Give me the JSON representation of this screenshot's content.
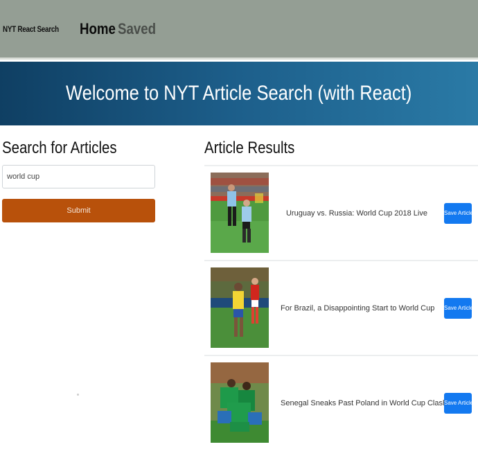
{
  "navbar": {
    "brand": "NYT React Search",
    "links": [
      "Home",
      "Saved"
    ]
  },
  "hero": {
    "title": "Welcome to NYT Article Search (with React)"
  },
  "search": {
    "heading": "Search for Articles",
    "query_value": "world cup",
    "submit_label": "Submit"
  },
  "results": {
    "heading": "Article Results",
    "articles": [
      {
        "title": "Uruguay vs. Russia: World Cup 2018 Live",
        "save_label": "Save Article"
      },
      {
        "title": "For Brazil, a Disappointing Start to World Cup",
        "save_label": "Save Article"
      },
      {
        "title": "Senegal Sneaks Past Poland in World Cup Clash",
        "save_label": "Save Article"
      }
    ]
  },
  "colors": {
    "navbar_bg": "#949e94",
    "hero_gradient_start": "#0f3f63",
    "hero_gradient_end": "#2a7aa6",
    "submit_bg": "#b8510b",
    "save_bg": "#1379f0"
  }
}
